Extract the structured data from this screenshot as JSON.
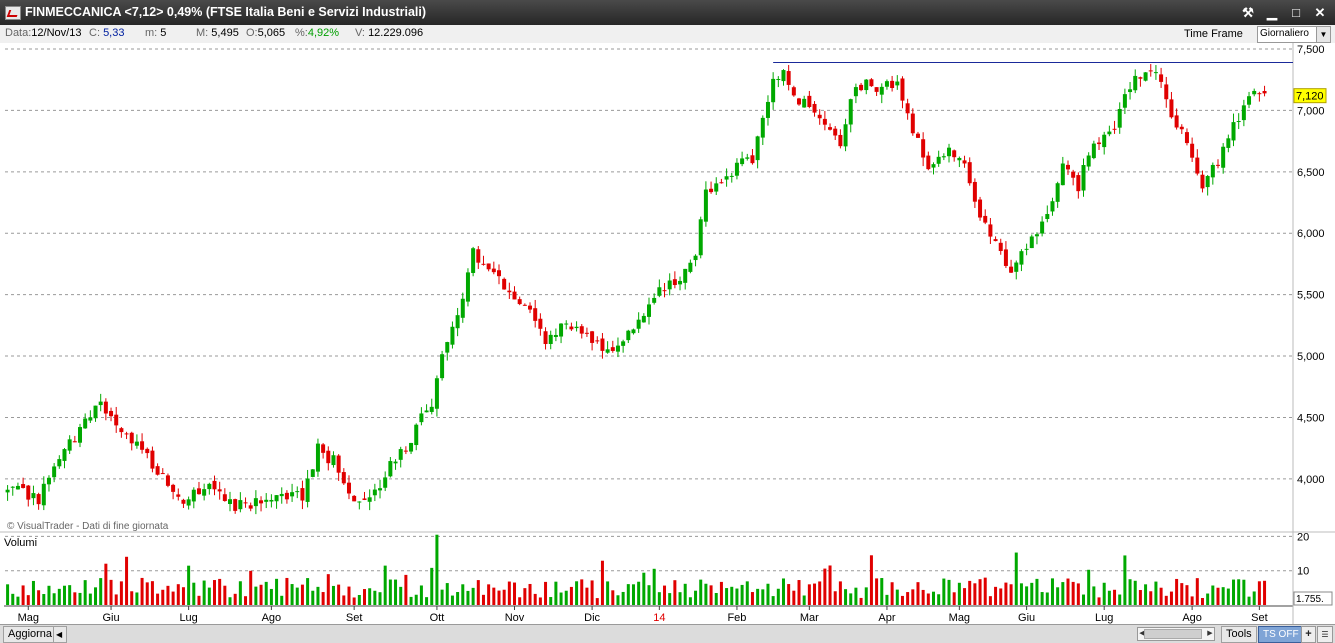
{
  "window": {
    "title": "FINMECCANICA <7,12> 0,49%  (FTSE Italia Beni e Servizi Industriali)",
    "buttons": [
      "wrench-icon",
      "minimize-icon",
      "maximize-icon",
      "close-icon"
    ]
  },
  "info": {
    "data_label": "Data:",
    "data_value": "12/Nov/13",
    "c_label": "C:",
    "c_value": "5,33",
    "m_label": "m:",
    "m_value": "5",
    "max_label": "M:",
    "max_value": "5,495",
    "open_label": "O:",
    "open_value": "5,065",
    "pct_label": "%:",
    "pct_value": "4,92%",
    "vol_label": "V:",
    "vol_value": "12.229.096",
    "timeframe_label": "Time Frame",
    "timeframe_value": "Giornaliero"
  },
  "chart_data": {
    "type": "candlestick",
    "ylim": [
      3600,
      7500
    ],
    "y_ticks": [
      "7,500",
      "7,000",
      "6,500",
      "6,000",
      "5,500",
      "5,000",
      "4,500",
      "4,000"
    ],
    "y_tick_values": [
      7500,
      7000,
      6500,
      6000,
      5500,
      5000,
      4500,
      4000
    ],
    "x_labels": [
      "Mag",
      "Giu",
      "Lug",
      "Ago",
      "Set",
      "Ott",
      "Nov",
      "Dic",
      "14",
      "Feb",
      "Mar",
      "Apr",
      "Mag",
      "Giu",
      "Lug",
      "Ago",
      "Set"
    ],
    "x_label_days": [
      4,
      20,
      35,
      51,
      67,
      83,
      98,
      113,
      126,
      141,
      155,
      170,
      184,
      197,
      212,
      229,
      242
    ],
    "n_days": 249,
    "price_anchors": [
      [
        0,
        3900
      ],
      [
        6,
        3850
      ],
      [
        10,
        4150
      ],
      [
        15,
        4450
      ],
      [
        18,
        4620
      ],
      [
        22,
        4400
      ],
      [
        27,
        4200
      ],
      [
        31,
        3950
      ],
      [
        34,
        3850
      ],
      [
        38,
        3950
      ],
      [
        43,
        3780
      ],
      [
        46,
        3800
      ],
      [
        52,
        3900
      ],
      [
        57,
        3850
      ],
      [
        60,
        4250
      ],
      [
        64,
        4100
      ],
      [
        67,
        3850
      ],
      [
        71,
        3900
      ],
      [
        74,
        4100
      ],
      [
        78,
        4350
      ],
      [
        82,
        4600
      ],
      [
        84,
        5000
      ],
      [
        88,
        5500
      ],
      [
        90,
        5850
      ],
      [
        93,
        5700
      ],
      [
        97,
        5500
      ],
      [
        101,
        5400
      ],
      [
        104,
        5150
      ],
      [
        108,
        5300
      ],
      [
        112,
        5200
      ],
      [
        116,
        5000
      ],
      [
        119,
        5100
      ],
      [
        124,
        5450
      ],
      [
        130,
        5650
      ],
      [
        133,
        5850
      ],
      [
        135,
        6300
      ],
      [
        140,
        6500
      ],
      [
        144,
        6600
      ],
      [
        148,
        7300
      ],
      [
        150,
        7300
      ],
      [
        153,
        7100
      ],
      [
        157,
        6900
      ],
      [
        161,
        6700
      ],
      [
        164,
        7200
      ],
      [
        168,
        7200
      ],
      [
        172,
        7250
      ],
      [
        175,
        6850
      ],
      [
        178,
        6500
      ],
      [
        182,
        6700
      ],
      [
        185,
        6600
      ],
      [
        188,
        6100
      ],
      [
        191,
        5900
      ],
      [
        194,
        5650
      ],
      [
        197,
        5900
      ],
      [
        201,
        6100
      ],
      [
        204,
        6600
      ],
      [
        207,
        6400
      ],
      [
        210,
        6700
      ],
      [
        214,
        6900
      ],
      [
        218,
        7250
      ],
      [
        222,
        7300
      ],
      [
        225,
        7000
      ],
      [
        228,
        6700
      ],
      [
        231,
        6400
      ],
      [
        234,
        6600
      ],
      [
        237,
        6850
      ],
      [
        240,
        7100
      ],
      [
        243,
        7120
      ]
    ],
    "resistance_line": {
      "day_start": 148,
      "day_end": 249,
      "value": 7390
    },
    "last_price": 7.12,
    "last_price_label": "7,120",
    "volume": {
      "label": "Volumi",
      "y_ticks": [
        "20",
        "10"
      ],
      "y_tick_values": [
        20,
        10
      ],
      "ylim": [
        0,
        21
      ],
      "last_label": "1.755."
    },
    "footer_note": "© VisualTrader - Dati di fine giornata",
    "colors": {
      "up": "#00a800",
      "down": "#e00000",
      "resistance": "#1a2a9a",
      "grid": "#9a9a9a",
      "price_tag": "#ffff00"
    }
  },
  "statusbar": {
    "refresh_label": "Aggiorna",
    "tools_label": "Tools",
    "ts_label": "TS OFF",
    "plus_label": "+"
  }
}
